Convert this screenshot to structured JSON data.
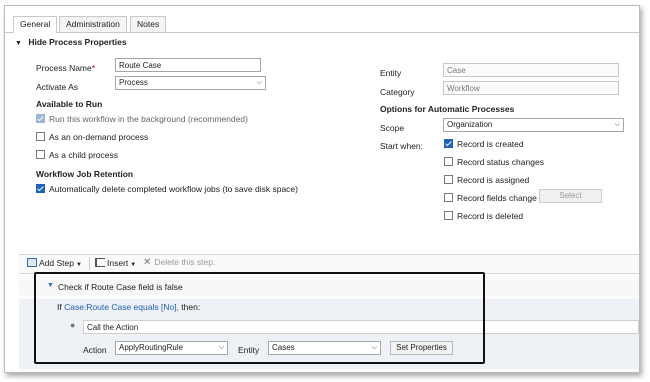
{
  "tabs": [
    {
      "label": "General"
    },
    {
      "label": "Administration"
    },
    {
      "label": "Notes"
    }
  ],
  "section_toggle": {
    "label": "Hide Process Properties"
  },
  "process_name": {
    "label": "Process Name",
    "required_mark": "*",
    "value": "Route Case"
  },
  "activate_as": {
    "label": "Activate As",
    "value": "Process"
  },
  "available_to_run": {
    "heading": "Available to Run",
    "options": [
      {
        "label": "Run this workflow in the background (recommended)",
        "checked": true,
        "disabled": true
      },
      {
        "label": "As an on-demand process",
        "checked": false
      },
      {
        "label": "As a child process",
        "checked": false
      }
    ]
  },
  "retention": {
    "heading": "Workflow Job Retention",
    "option": {
      "label": "Automatically delete completed workflow jobs (to save disk space)",
      "checked": true
    }
  },
  "entity": {
    "label": "Entity",
    "value": "Case"
  },
  "category": {
    "label": "Category",
    "value": "Workflow"
  },
  "automatic": {
    "heading": "Options for Automatic Processes",
    "scope_label": "Scope",
    "scope_value": "Organization",
    "start_when_label": "Start when:",
    "options": [
      {
        "label": "Record is created",
        "checked": true
      },
      {
        "label": "Record status changes",
        "checked": false
      },
      {
        "label": "Record is assigned",
        "checked": false
      },
      {
        "label": "Record fields change",
        "checked": false
      },
      {
        "label": "Record is deleted",
        "checked": false
      }
    ],
    "select_button": "Select"
  },
  "toolbar": {
    "add_step": "Add Step",
    "insert": "Insert",
    "delete": "Delete this step."
  },
  "step": {
    "title": "Check if Route Case field is false",
    "condition_prefix": "If",
    "condition_link": "Case:Route Case equals [No],",
    "condition_suffix": "then:",
    "action_description": "Call the Action",
    "action_label": "Action",
    "action_value": "ApplyRoutingRule",
    "entity_label": "Entity",
    "entity_value": "Cases",
    "set_properties": "Set Properties"
  }
}
